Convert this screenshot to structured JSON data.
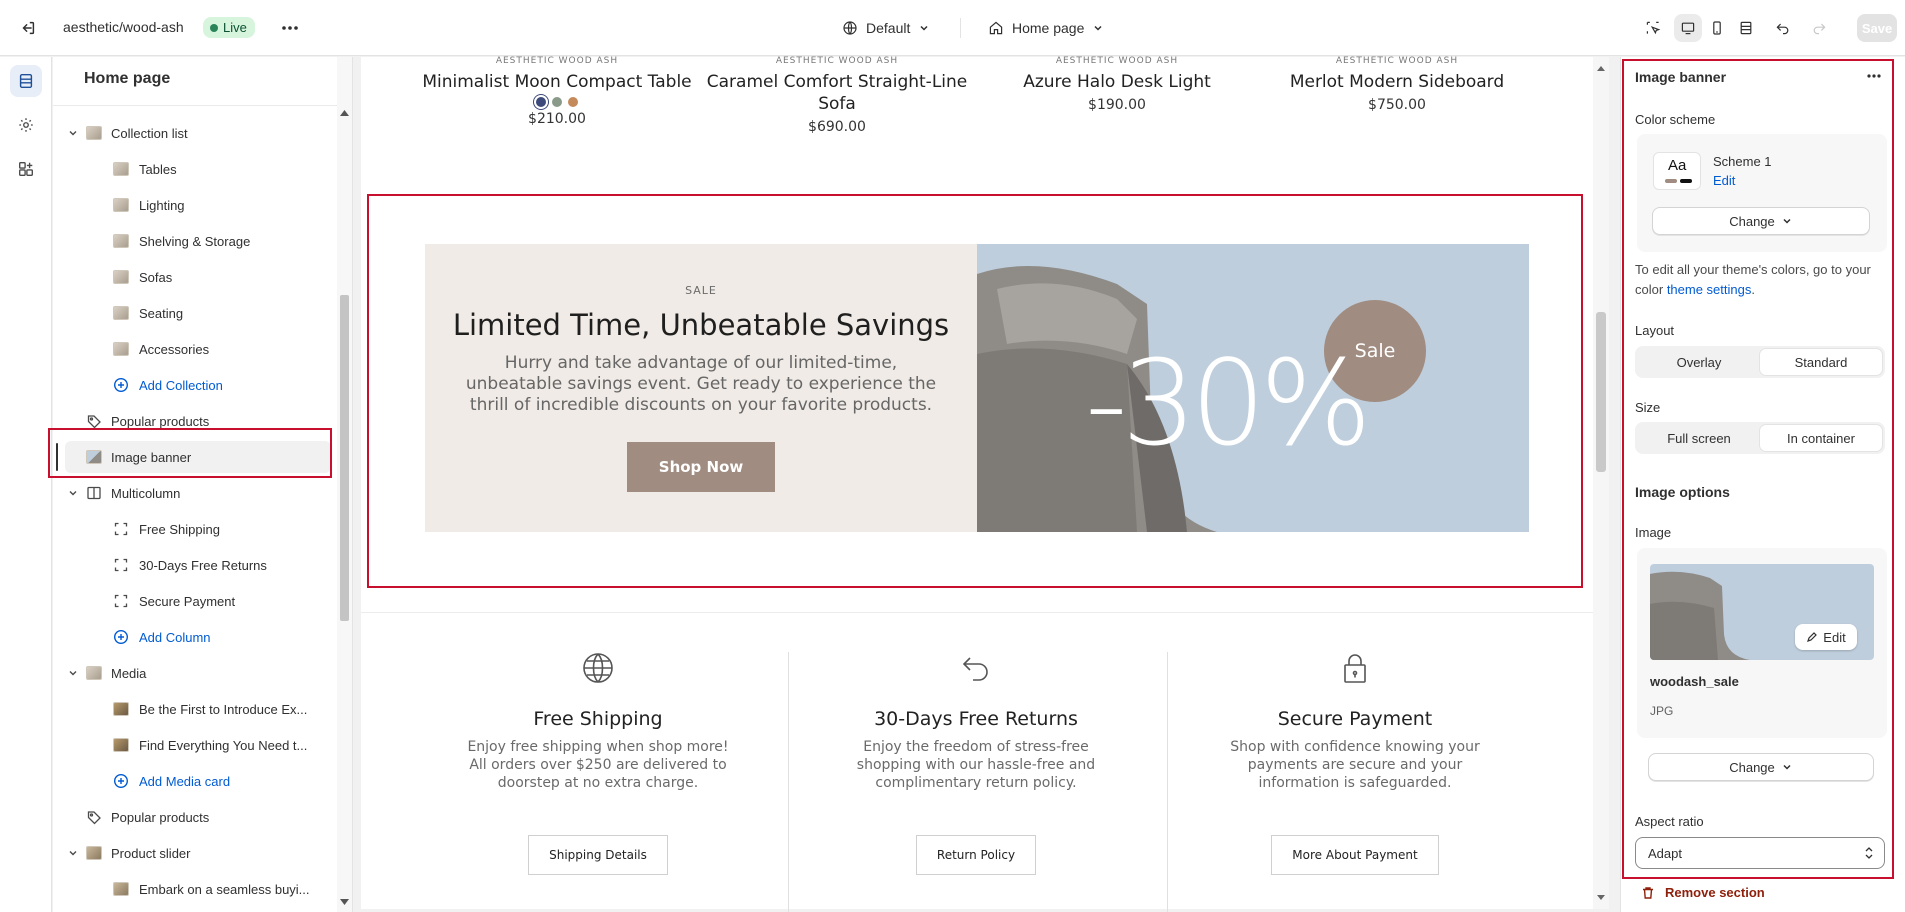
{
  "topbar": {
    "store_name": "aesthetic/wood-ash",
    "status": "Live",
    "theme": "Default",
    "page": "Home page",
    "save_label": "Save"
  },
  "tree": {
    "title": "Home page",
    "items": [
      {
        "label": "Collection list",
        "level": 1,
        "icon": "collection-list-icon",
        "chevron": true
      },
      {
        "label": "Tables",
        "level": 2,
        "icon": "collection-thumb"
      },
      {
        "label": "Lighting",
        "level": 2,
        "icon": "collection-thumb"
      },
      {
        "label": "Shelving & Storage",
        "level": 2,
        "icon": "collection-thumb"
      },
      {
        "label": "Sofas",
        "level": 2,
        "icon": "collection-thumb"
      },
      {
        "label": "Seating",
        "level": 2,
        "icon": "collection-thumb"
      },
      {
        "label": "Accessories",
        "level": 2,
        "icon": "collection-thumb"
      },
      {
        "label": "Add Collection",
        "level": 2,
        "icon": "plus-circle-icon",
        "add": true
      },
      {
        "label": "Popular products",
        "level": 1,
        "icon": "tag-icon"
      },
      {
        "label": "Image banner",
        "level": 1,
        "icon": "image-icon",
        "selected": true
      },
      {
        "label": "Multicolumn",
        "level": 1,
        "icon": "columns-icon",
        "chevron": true
      },
      {
        "label": "Free Shipping",
        "level": 2,
        "icon": "column-block-icon"
      },
      {
        "label": "30-Days Free Returns",
        "level": 2,
        "icon": "column-block-icon"
      },
      {
        "label": "Secure Payment",
        "level": 2,
        "icon": "column-block-icon"
      },
      {
        "label": "Add Column",
        "level": 2,
        "icon": "plus-circle-icon",
        "add": true
      },
      {
        "label": "Media",
        "level": 1,
        "icon": "media-icon",
        "chevron": true
      },
      {
        "label": "Be the First to Introduce Ex...",
        "level": 2,
        "icon": "media-thumb"
      },
      {
        "label": "Find Everything You Need t...",
        "level": 2,
        "icon": "media-thumb"
      },
      {
        "label": "Add Media card",
        "level": 2,
        "icon": "plus-circle-icon",
        "add": true
      },
      {
        "label": "Popular products",
        "level": 1,
        "icon": "tag-icon"
      },
      {
        "label": "Product slider",
        "level": 1,
        "icon": "slider-icon",
        "chevron": true
      },
      {
        "label": "Embark on a seamless buyi...",
        "level": 2,
        "icon": "slider-thumb"
      }
    ]
  },
  "preview": {
    "products": [
      {
        "brand": "AESTHETIC WOOD ASH",
        "name": "Minimalist Moon Compact Table",
        "price": "$210.00",
        "swatches": [
          "#3b4a7a",
          "#8a9a8a",
          "#c48a5a"
        ]
      },
      {
        "brand": "AESTHETIC WOOD ASH",
        "name": "Caramel Comfort Straight-Line Sofa",
        "price": "$690.00"
      },
      {
        "brand": "AESTHETIC WOOD ASH",
        "name": "Azure Halo Desk Light",
        "price": "$190.00"
      },
      {
        "brand": "AESTHETIC WOOD ASH",
        "name": "Merlot Modern Sideboard",
        "price": "$750.00"
      }
    ],
    "banner": {
      "subheading": "SALE",
      "heading": "Limited Time, Unbeatable Savings",
      "text": "Hurry and take advantage of our limited-time, unbeatable savings event. Get ready to experience the thrill of incredible discounts on your favorite products.",
      "button": "Shop Now",
      "percent": "-30%",
      "badge": "Sale"
    },
    "features": [
      {
        "icon": "globe-icon",
        "title": "Free Shipping",
        "text": "Enjoy free shipping when shop more! All orders over $250 are delivered to doorstep at no extra charge.",
        "button": "Shipping Details"
      },
      {
        "icon": "return-arrow-icon",
        "title": "30-Days Free Returns",
        "text": "Enjoy the freedom of stress-free shopping with our hassle-free and complimentary return policy.",
        "button": "Return Policy"
      },
      {
        "icon": "lock-icon",
        "title": "Secure Payment",
        "text": "Shop with confidence knowing your payments are secure and your information is safeguarded.",
        "button": "More About Payment"
      }
    ]
  },
  "panel": {
    "title": "Image banner",
    "color_scheme_label": "Color scheme",
    "scheme_sample": "Aa",
    "scheme_name": "Scheme 1",
    "scheme_edit": "Edit",
    "change_label": "Change",
    "hint_prefix": "To edit all your theme's colors, go to your color",
    "hint_link": "theme settings",
    "hint_suffix": ".",
    "layout_label": "Layout",
    "layout_options": [
      "Overlay",
      "Standard"
    ],
    "layout_selected": "Standard",
    "size_label": "Size",
    "size_options": [
      "Full screen",
      "In container"
    ],
    "size_selected": "In container",
    "image_options_heading": "Image options",
    "image_label": "Image",
    "image_edit": "Edit",
    "image_name": "woodash_sale",
    "image_type": "JPG",
    "aspect_label": "Aspect ratio",
    "aspect_value": "Adapt",
    "remove_label": "Remove section"
  },
  "colors": {
    "accent_red": "#c8102e",
    "link_blue": "#005bd3",
    "banner_button": "#a08c80",
    "banner_blue": "#bfcedd",
    "banner_beige": "#f0ebe6"
  }
}
